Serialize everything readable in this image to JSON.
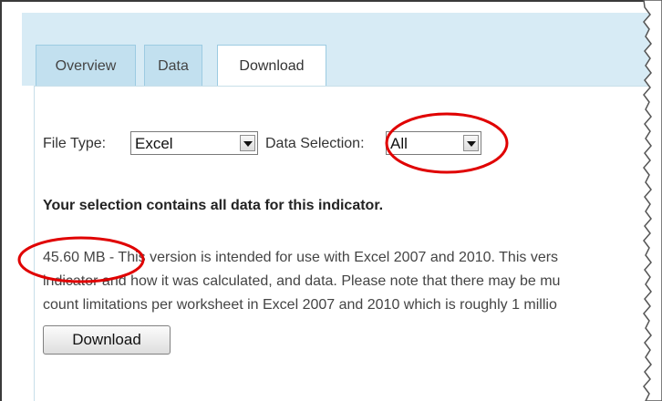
{
  "tabs": [
    {
      "label": "Overview",
      "active": false
    },
    {
      "label": "Data",
      "active": false
    },
    {
      "label": "Download",
      "active": true
    }
  ],
  "form": {
    "file_type_label": "File Type:",
    "file_type_value": "Excel",
    "data_selection_label": "Data Selection:",
    "data_selection_value": "All"
  },
  "selection_note": "Your selection contains all data for this indicator.",
  "description": {
    "file_size": "45.60 MB",
    "separator": " - ",
    "line1": "This version is intended for use with Excel 2007 and 2010. This vers",
    "line2": "indicator and how it was calculated, and data. Please note that there may be mu",
    "line3": "count limitations per worksheet in Excel 2007 and 2010 which is roughly 1 millio"
  },
  "download_button_label": "Download",
  "colors": {
    "tab_strip": "#d7ebf5",
    "tab_inactive": "#c2e0ef",
    "annotation_red": "#e00000"
  }
}
